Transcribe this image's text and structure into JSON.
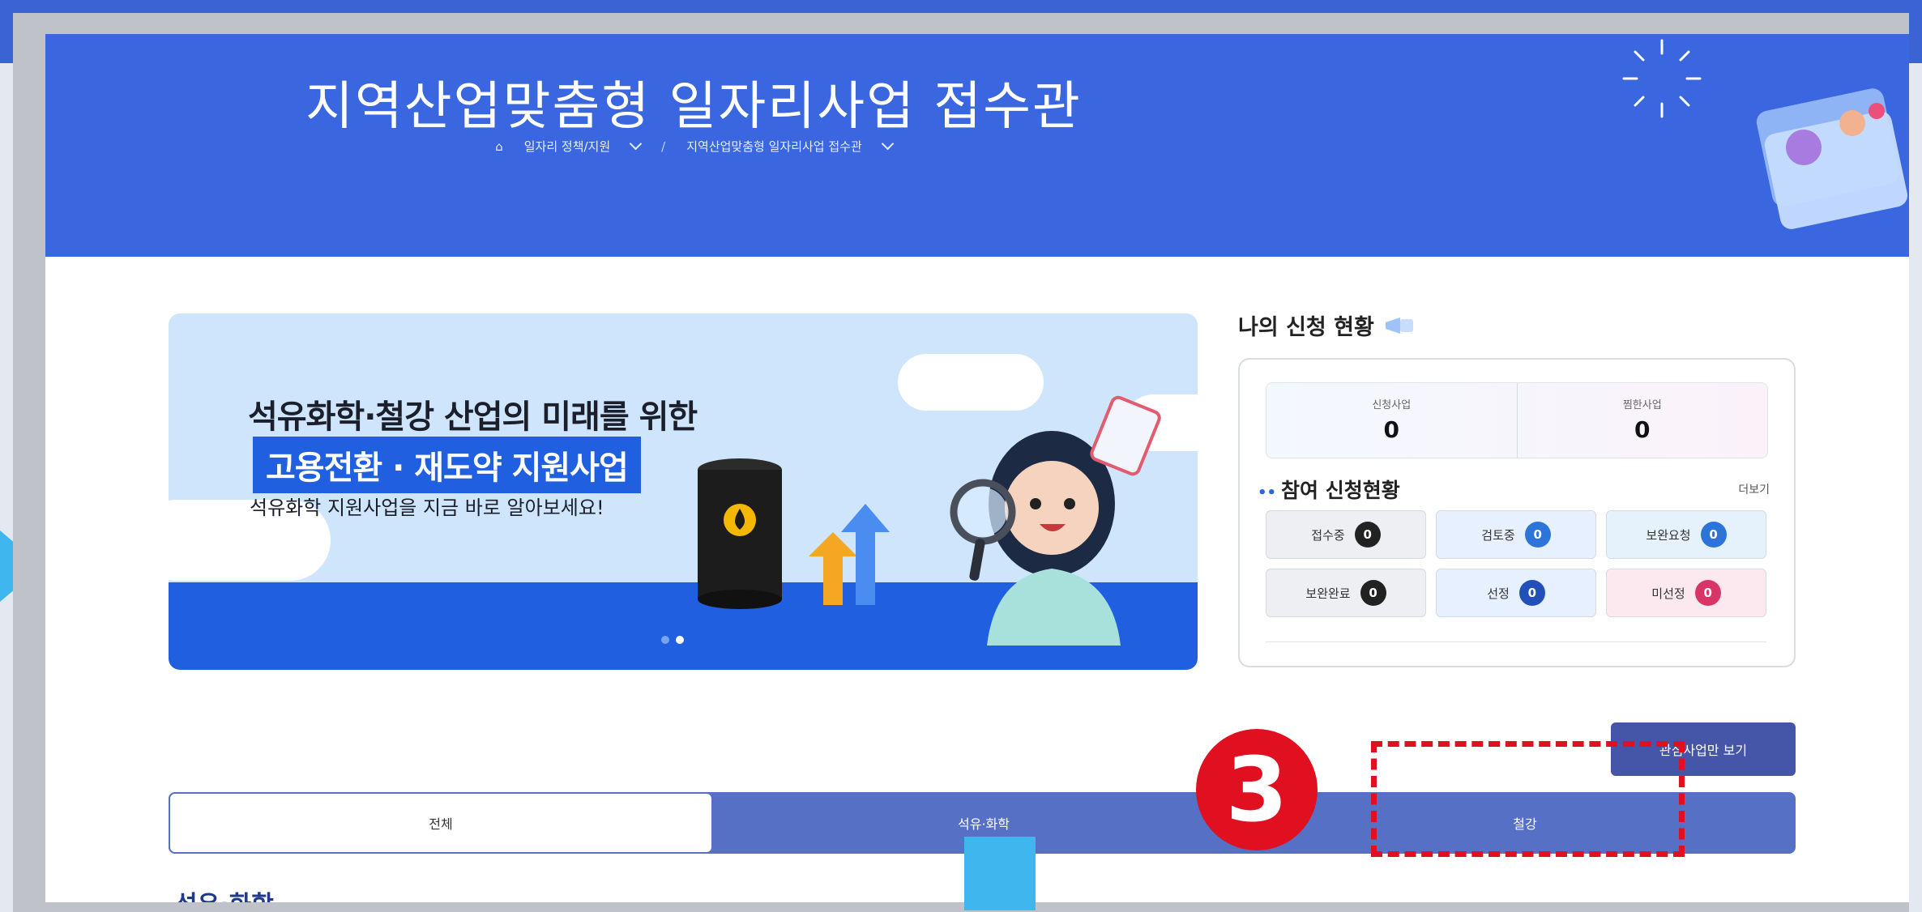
{
  "hero": {
    "title": "지역산업맞춤형 일자리사업 접수관",
    "breadcrumb": [
      "일자리 정책/지원",
      "/",
      "지역산업맞춤형 일자리사업 접수관"
    ]
  },
  "banner": {
    "headline": "석유화학·철강 산업의 미래를 위한",
    "highlight": "고용전환 · 재도약 지원사업",
    "subtext": "석유화학 지원사업을 지금 바로 알아보세요!",
    "slides": 2,
    "active_slide": 2
  },
  "status": {
    "title": "나의 신청 현황",
    "counts": [
      {
        "label": "신청사업",
        "value": "0"
      },
      {
        "label": "찜한사업",
        "value": "0"
      }
    ],
    "participation_title": "참여 신청현황",
    "more_label": "더보기",
    "items": [
      {
        "label": "접수중",
        "value": "0"
      },
      {
        "label": "검토중",
        "value": "0"
      },
      {
        "label": "보완요청",
        "value": "0"
      },
      {
        "label": "보완완료",
        "value": "0"
      },
      {
        "label": "선정",
        "value": "0"
      },
      {
        "label": "미선정",
        "value": "0"
      }
    ]
  },
  "interest_button": "관심사업만 보기",
  "tabs": [
    "전체",
    "석유·화학",
    "철강"
  ],
  "active_tab": "전체",
  "section_label": "석유·화학",
  "annotation": {
    "step_number": "3",
    "color": "#e01020"
  },
  "colors": {
    "hero_blue": "#3a66e0",
    "tab_bar": "#5670c6",
    "accent_cyan": "#3fb6ee"
  }
}
